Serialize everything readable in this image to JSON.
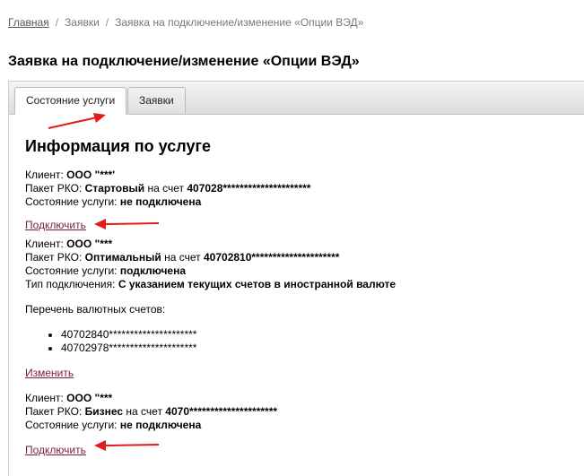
{
  "breadcrumb": {
    "home": "Главная",
    "sep": "/",
    "requests": "Заявки",
    "current": "Заявка на подключение/изменение «Опции ВЭД»"
  },
  "page_title": "Заявка на подключение/изменение «Опции ВЭД»",
  "tabs": [
    {
      "label": "Состояние услуги",
      "active": true
    },
    {
      "label": "Заявки",
      "active": false
    }
  ],
  "info": {
    "title": "Информация по услуге",
    "labels": {
      "client": "Клиент:",
      "package": "Пакет РКО:",
      "on_account": "на счет",
      "state": "Состояние услуги:",
      "conn_type": "Тип подключения:",
      "accounts_list": "Перечень валютных счетов:"
    },
    "blocks": [
      {
        "client": "ООО \"***'",
        "package": "Стартовый",
        "account": "407028*********************",
        "state": "не подключена",
        "action": "Подключить"
      },
      {
        "client": "ООО \"***",
        "package": "Оптимальный",
        "account": "40702810*********************",
        "state": "подключена",
        "conn_type": "С указанием текущих счетов в иностранной валюте",
        "accounts": [
          "40702840*********************",
          "40702978*********************"
        ],
        "action": "Изменить"
      },
      {
        "client": "ООО \"***",
        "package": "Бизнес",
        "account": "4070*********************",
        "state": "не подключена",
        "action": "Подключить"
      }
    ]
  },
  "colors": {
    "link": "#7b1e3a",
    "annotation_arrow": "#e01b1b"
  },
  "icons": [
    "red-arrow-icon"
  ]
}
